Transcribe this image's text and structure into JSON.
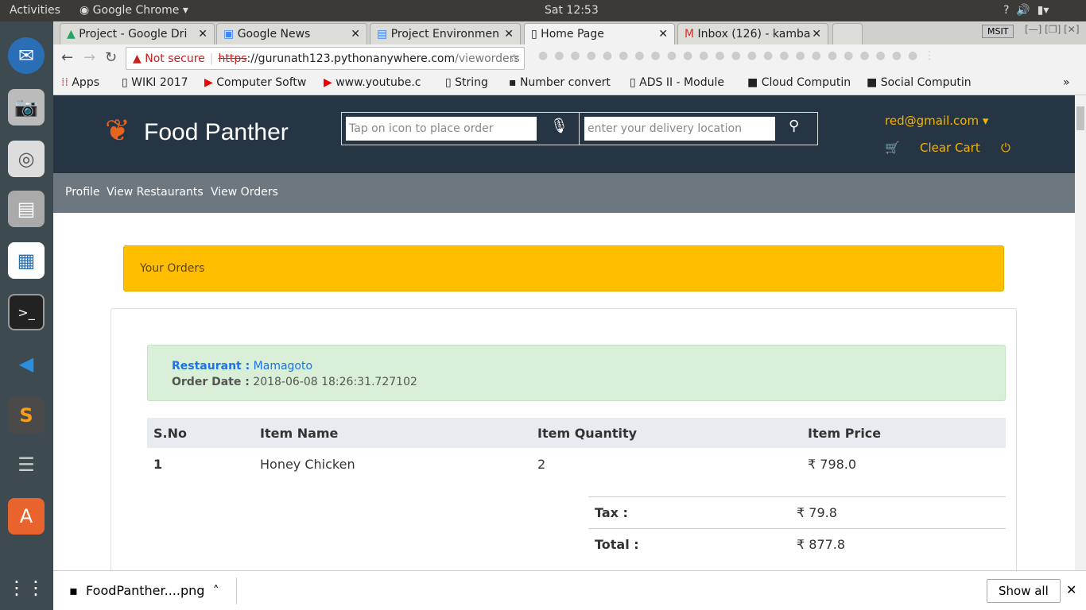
{
  "system": {
    "activities": "Activities",
    "app": "Google Chrome",
    "clock": "Sat 12:53"
  },
  "tabs": [
    {
      "label": "Project - Google Dri"
    },
    {
      "label": "Google News"
    },
    {
      "label": "Project Environmen"
    },
    {
      "label": "Home Page"
    },
    {
      "label": "Inbox (126) - kamba"
    }
  ],
  "window": {
    "profile": "MSIT"
  },
  "omnibox": {
    "security": "Not secure",
    "scheme": "https",
    "rest_host": "://gurunath123.pythonanywhere.com",
    "path": "/vieworders"
  },
  "bookmarks": [
    "Apps",
    "WIKI 2017",
    "Computer Softw",
    "www.youtube.c",
    "String",
    "Number convert",
    "ADS II - Module",
    "Cloud Computin",
    "Social Computin"
  ],
  "site": {
    "brand": "Food Panther",
    "order_placeholder": "Tap on icon to place order",
    "location_placeholder": "enter your delivery location",
    "user": "red@gmail.com",
    "clear_cart": "Clear Cart",
    "nav": [
      "Profile",
      "View Restaurants",
      "View Orders"
    ]
  },
  "orders": {
    "heading": "Your Orders",
    "restaurant_label": "Restaurant :",
    "restaurant": "Mamagoto",
    "date_label": "Order Date :",
    "date": "2018-06-08 18:26:31.727102",
    "columns": [
      "S.No",
      "Item Name",
      "Item Quantity",
      "Item Price"
    ],
    "rows": [
      {
        "sno": "1",
        "name": "Honey Chicken",
        "qty": "2",
        "price": "₹ 798.0"
      }
    ],
    "tax_label": "Tax :",
    "tax": "₹ 79.8",
    "total_label": "Total :",
    "total": "₹ 877.8"
  },
  "download": {
    "file": "FoodPanther....png",
    "show_all": "Show all"
  }
}
